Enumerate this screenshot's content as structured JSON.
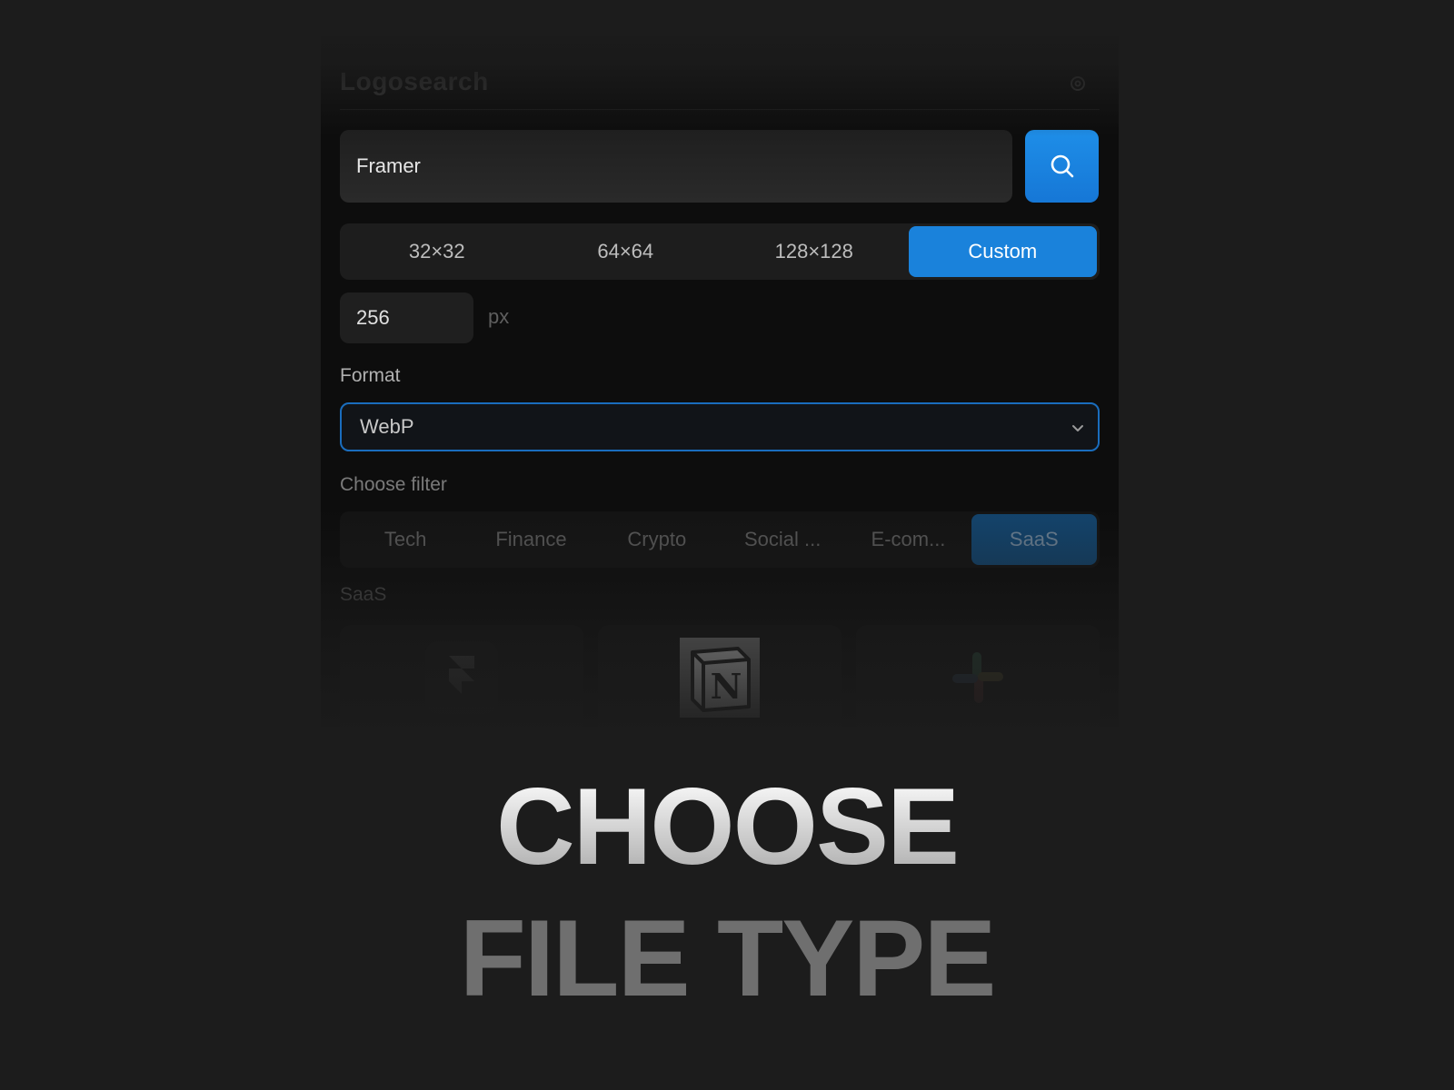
{
  "app": {
    "title": "Logosearch"
  },
  "search": {
    "value": "Framer"
  },
  "size_options": [
    "32×32",
    "64×64",
    "128×128",
    "Custom"
  ],
  "size_selected": "Custom",
  "custom_size": {
    "value": "256",
    "unit": "px"
  },
  "format": {
    "label": "Format",
    "selected": "WebP"
  },
  "filter": {
    "label": "Choose filter",
    "options": [
      "Tech",
      "Finance",
      "Crypto",
      "Social ...",
      "E-com...",
      "SaaS"
    ],
    "selected": "SaaS"
  },
  "results": {
    "section_title": "SaaS",
    "logos": [
      "framer-logo",
      "notion-logo",
      "slack-logo"
    ]
  },
  "headline": {
    "line1": "CHOOSE",
    "line2": "FILE TYPE"
  },
  "colors": {
    "accent": "#1a82db",
    "background": "#1c1c1c",
    "panel": "#0d0d0d"
  }
}
